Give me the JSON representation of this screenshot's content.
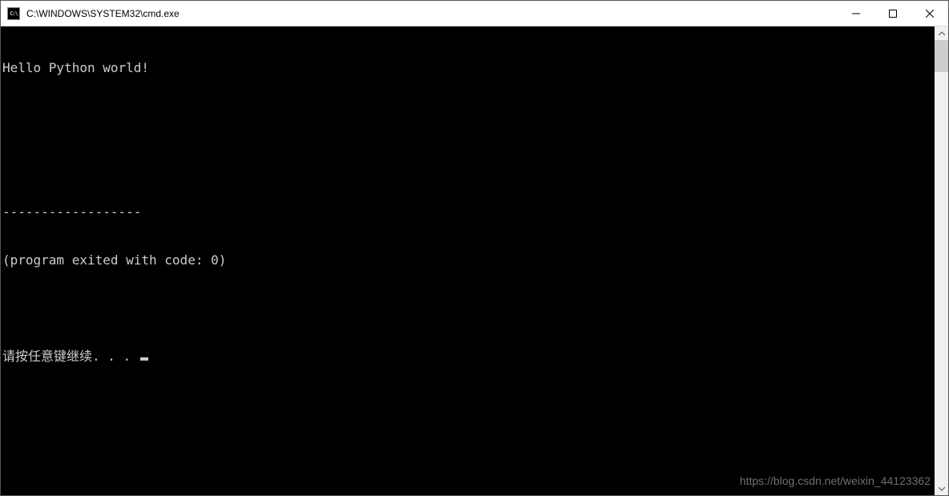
{
  "window": {
    "title": "C:\\WINDOWS\\SYSTEM32\\cmd.exe",
    "icon_name": "cmd-icon",
    "icon_text": "C:\\"
  },
  "terminal": {
    "lines": {
      "line1": "Hello Python world!",
      "line2": "",
      "line3": "",
      "line4": "------------------",
      "line5": "(program exited with code: 0)",
      "line6": "",
      "line7_text": "请按任意键继续. . . "
    }
  },
  "watermark": "https://blog.csdn.net/weixin_44123362"
}
